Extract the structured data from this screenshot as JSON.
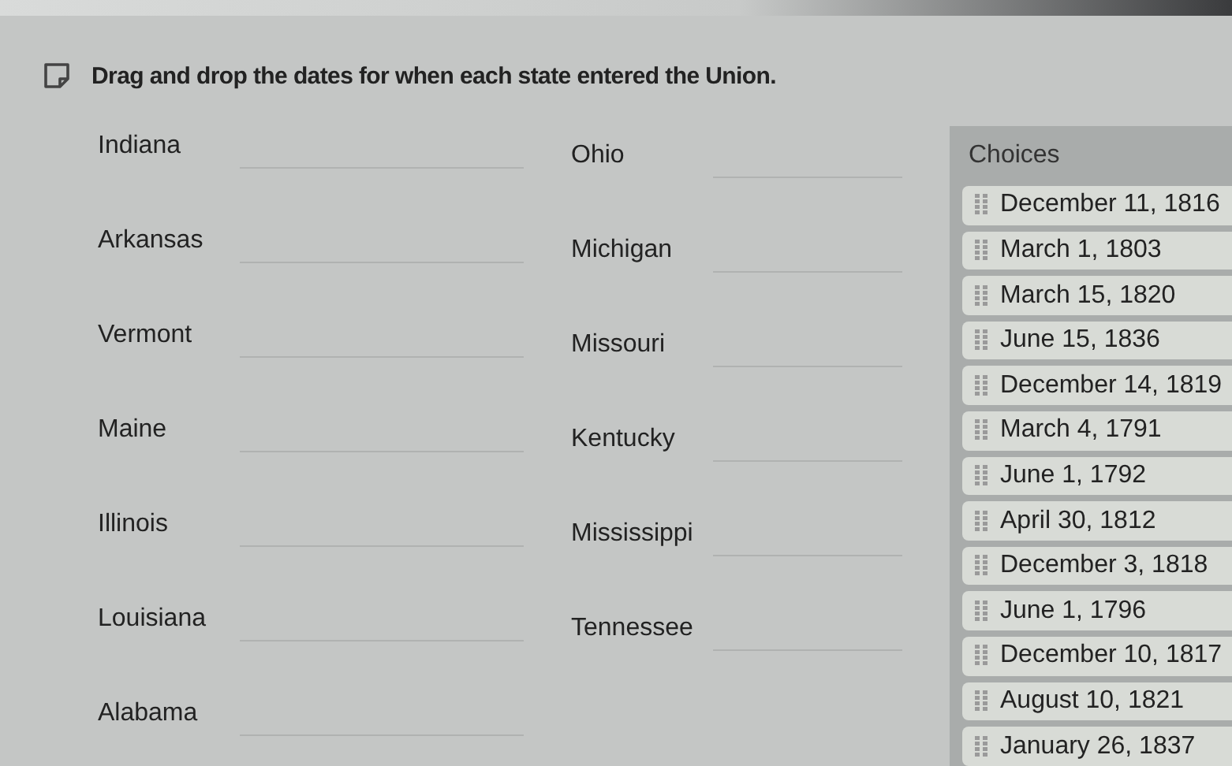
{
  "question": "Drag and drop the dates for when each state entered the Union.",
  "targets": [
    {
      "state": "Indiana"
    },
    {
      "state": "Ohio"
    },
    {
      "state": "Arkansas"
    },
    {
      "state": "Michigan"
    },
    {
      "state": "Vermont"
    },
    {
      "state": "Missouri"
    },
    {
      "state": "Maine"
    },
    {
      "state": "Kentucky"
    },
    {
      "state": "Illinois"
    },
    {
      "state": "Mississippi"
    },
    {
      "state": "Louisiana"
    },
    {
      "state": "Tennessee"
    },
    {
      "state": "Alabama"
    }
  ],
  "choices": {
    "title": "Choices",
    "items": [
      "December 11, 1816",
      "March 1, 1803",
      "March 15, 1820",
      "June 15, 1836",
      "December 14, 1819",
      "March 4, 1791",
      "June 1, 1792",
      "April 30, 1812",
      "December 3, 1818",
      "June 1, 1796",
      "December 10, 1817",
      "August 10, 1821",
      "January 26, 1837"
    ]
  }
}
